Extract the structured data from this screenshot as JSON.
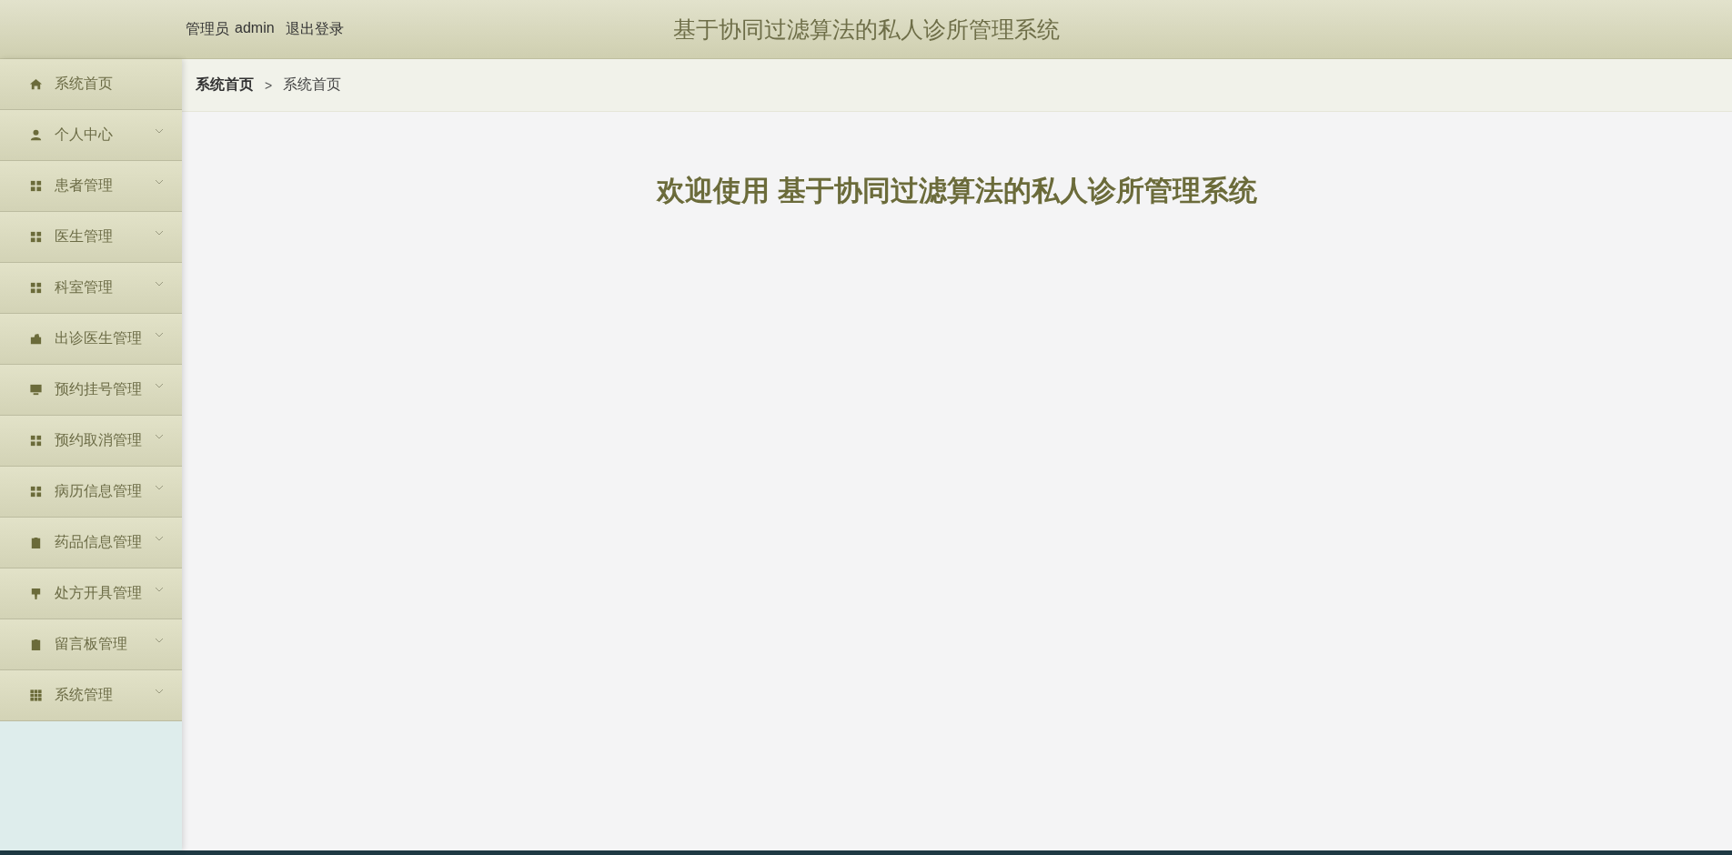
{
  "header": {
    "user_role": "管理员",
    "user_name": "admin",
    "logout": "退出登录",
    "title": "基于协同过滤算法的私人诊所管理系统"
  },
  "sidebar": {
    "items": [
      {
        "label": "系统首页",
        "selected": false
      },
      {
        "label": "个人中心",
        "selected": false,
        "expanded": false
      },
      {
        "label": "患者管理",
        "selected": false,
        "expanded": false
      },
      {
        "label": "医生管理",
        "selected": false,
        "expanded": false
      },
      {
        "label": "科室管理",
        "selected": false,
        "expanded": false
      },
      {
        "label": "出诊医生管理",
        "selected": false,
        "expanded": false
      },
      {
        "label": "预约挂号管理",
        "selected": false,
        "expanded": false
      },
      {
        "label": "预约取消管理",
        "selected": false,
        "expanded": false
      },
      {
        "label": "病历信息管理",
        "selected": false,
        "expanded": false
      },
      {
        "label": "药品信息管理",
        "selected": false,
        "expanded": false
      },
      {
        "label": "处方开具管理",
        "selected": false,
        "expanded": false
      },
      {
        "label": "留言板管理",
        "selected": false,
        "expanded": false
      },
      {
        "label": "系统管理",
        "selected": false,
        "expanded": false
      }
    ]
  },
  "breadcrumb": {
    "items": [
      "系统首页",
      "系统首页"
    ],
    "separator": ">"
  },
  "welcome": "欢迎使用 基于协同过滤算法的私人诊所管理系统"
}
